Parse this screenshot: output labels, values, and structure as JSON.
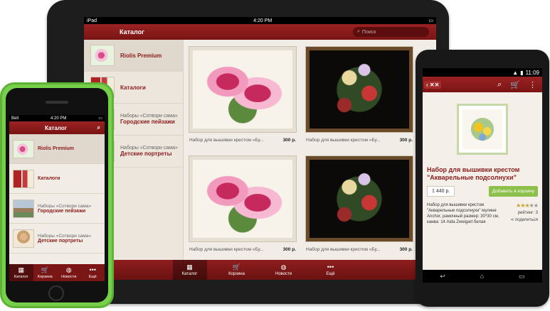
{
  "ipad": {
    "status": {
      "carrier": "iPad",
      "time": "4:20 PM"
    },
    "nav": {
      "title": "Каталог",
      "search_placeholder": "Поиск"
    },
    "sidebar": [
      {
        "title": "Riolis Premium",
        "subtitle": ""
      },
      {
        "title": "Каталоги",
        "subtitle": ""
      },
      {
        "title": "Городские пейзажи",
        "subtitle": "Наборы «Сотвори сама»"
      },
      {
        "title": "Детские портреты",
        "subtitle": "Наборы «Сотвори сама»"
      }
    ],
    "products": [
      {
        "name": "Набор для вышивки крестом «Бу...",
        "price": "300 р."
      },
      {
        "name": "Набор для вышивки крестом «Бу...",
        "price": "300 р."
      },
      {
        "name": "Набор для вышивки крестом «Бу...",
        "price": "300 р."
      },
      {
        "name": "Набор для вышивки крестом «Бу...",
        "price": "300 р."
      }
    ],
    "tabs": [
      {
        "label": "Каталог",
        "icon": "grid-icon",
        "glyph": "▦"
      },
      {
        "label": "Корзина",
        "icon": "cart-icon",
        "glyph": "🛒"
      },
      {
        "label": "Новости",
        "icon": "globe-icon",
        "glyph": "◍"
      },
      {
        "label": "Ещё",
        "icon": "more-icon",
        "glyph": "•••"
      }
    ]
  },
  "iphone": {
    "status": {
      "carrier": "Bell",
      "time": "4:20 PM"
    },
    "nav": {
      "title": "Каталог"
    },
    "items": [
      {
        "title": "Riolis Premium",
        "subtitle": ""
      },
      {
        "title": "Каталоги",
        "subtitle": ""
      },
      {
        "title": "Городские пейзажи",
        "subtitle": "Наборы «Сотвори сама»"
      },
      {
        "title": "Детские портреты",
        "subtitle": "Наборы «Сотвори сама»"
      }
    ],
    "tabs": [
      {
        "label": "Каталог",
        "glyph": "▦"
      },
      {
        "label": "Корзина",
        "glyph": "🛒"
      },
      {
        "label": "Новости",
        "glyph": "◍"
      },
      {
        "label": "Ещё",
        "glyph": "•••"
      }
    ]
  },
  "android": {
    "status": {
      "time": "11:09"
    },
    "logo": "‹ ✕✕",
    "product": {
      "title": "Набор для вышивки крестом \"Акварельные подсолнухи\"",
      "price": "1 440 р.",
      "buy_label": "Добавить в корзину",
      "description": "Набор для вышивки крестом \"Акварельные подсолнухи\" мулине Anchor, рамочный размер: 30*30 см, канва: 14 Aida Zweigart белая",
      "rating_label": "рейтинг: 3",
      "rating": 3,
      "share_label": "поделиться"
    }
  }
}
